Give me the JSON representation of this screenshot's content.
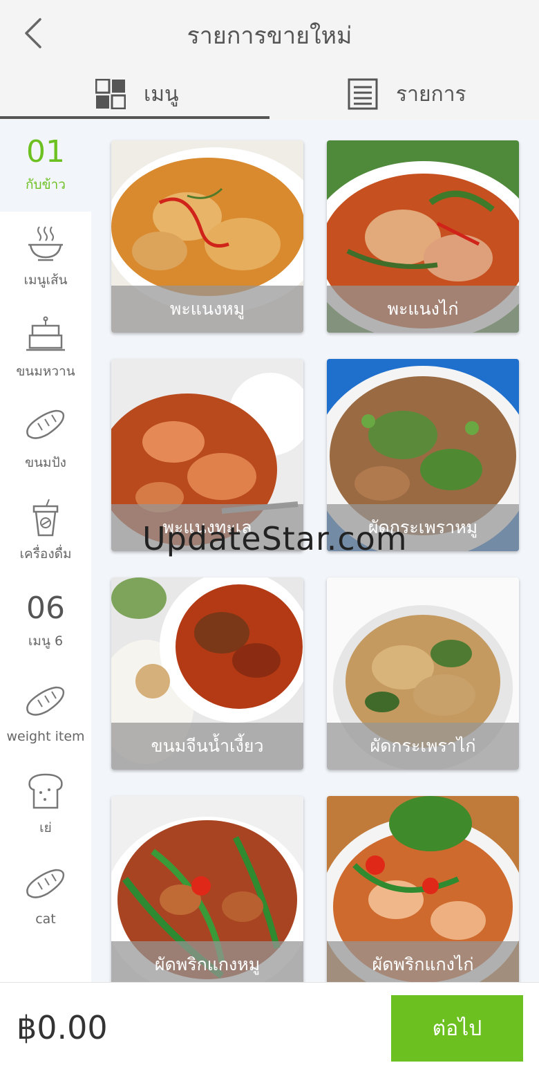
{
  "header": {
    "title": "รายการขายใหม่"
  },
  "tabs": [
    {
      "label": "เมนู",
      "icon": "grid-icon"
    },
    {
      "label": "รายการ",
      "icon": "list-icon"
    }
  ],
  "sidebar": {
    "items": [
      {
        "code": "01",
        "label": "กับข้าว",
        "active": true
      },
      {
        "label": "เมนูเส้น",
        "icon": "noodle-bowl-icon"
      },
      {
        "label": "ขนมหวาน",
        "icon": "cake-icon"
      },
      {
        "label": "ขนมปัง",
        "icon": "bread-icon"
      },
      {
        "label": "เครื่องดื่ม",
        "icon": "drink-cup-icon"
      },
      {
        "code": "06",
        "label": "เมนู 6"
      },
      {
        "label": "weight item",
        "icon": "bread-icon"
      },
      {
        "label": "เย่",
        "icon": "toast-icon"
      },
      {
        "label": "cat",
        "icon": "bread-icon"
      }
    ]
  },
  "menu_items": [
    {
      "name": "พะแนงหมู"
    },
    {
      "name": "พะแนงไก่"
    },
    {
      "name": "พะแนงทะเล"
    },
    {
      "name": "ผัดกระเพราหมู"
    },
    {
      "name": "ขนมจีนน้ำเงี้ยว"
    },
    {
      "name": "ผัดกระเพราไก่"
    },
    {
      "name": "ผัดพริกแกงหมู"
    },
    {
      "name": "ผัดพริกแกงไก่"
    }
  ],
  "watermark": "UpdateStar.com",
  "footer": {
    "total": "฿0.00",
    "next_label": "ต่อไป"
  },
  "colors": {
    "accent": "#6cc020",
    "grid_bg": "#f2f5fa",
    "header_bg": "#f4f4f4"
  }
}
